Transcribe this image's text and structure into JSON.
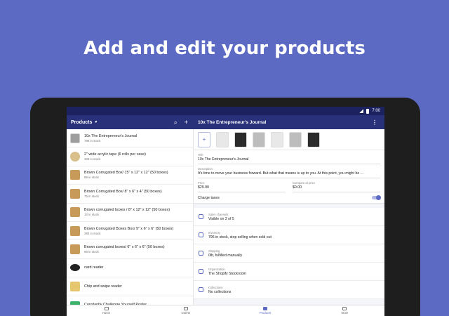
{
  "headline": "Add and edit your products",
  "status": {
    "time": "7:00"
  },
  "appbar": {
    "products_title": "Products",
    "search_icon": "⌕",
    "add_icon": "+",
    "detail_title": "10x The Entrepreneur's Journal",
    "more_icon": "⋮"
  },
  "products": [
    {
      "title": "10x The Entrepreneur's Journal",
      "stock": "796 in stock",
      "thumb": "book"
    },
    {
      "title": "2\" wide acrylic tape (6 rolls per case)",
      "stock": "323 in stock",
      "thumb": "tape"
    },
    {
      "title": "Brown Corrugated Box/ 15\" x 12\" x 12\" (50 boxes)",
      "stock": "88 in stock",
      "thumb": "box"
    },
    {
      "title": "Brown Corrugated Box/ 8\" x 6\" x 4\" (50 boxes)",
      "stock": "75 in stock",
      "thumb": "box"
    },
    {
      "title": "Brown corrugated boxes /  8\" x 12\" x 12\" (50 boxes)",
      "stock": "10 in stock",
      "thumb": "box"
    },
    {
      "title": "Brown Corrugated Boxes Box/ 9\" x 6\" x 6\" (50 boxes)",
      "stock": "393 in stock",
      "thumb": "box"
    },
    {
      "title": "Brown corrugated boxes/ 6\" x 6\" x 6\" (50 boxes)",
      "stock": "66 in stock",
      "thumb": "box"
    },
    {
      "title": "card reader",
      "stock": "",
      "thumb": "reader"
    },
    {
      "title": "Chip and swipe reader",
      "stock": "",
      "thumb": "chip"
    },
    {
      "title": "Constantly Challenge Yourself Poster",
      "stock": "",
      "thumb": "poster"
    }
  ],
  "detail": {
    "add_image_icon": "+",
    "title_label": "Title",
    "title_value": "10x The Entrepreneur's Journal",
    "description_label": "Description",
    "description_value": "It's time to move your business forward. But what that means is up to you. At this point, you might be ...",
    "price_label": "Price",
    "price_value": "$29.90",
    "compare_label": "Compare at price",
    "compare_value": "$0.00",
    "charge_taxes": "Charge taxes",
    "charge_taxes_on": true,
    "sales_label": "Sales channels",
    "sales_value": "Visible on 2 of 5",
    "inventory_label": "Inventory",
    "inventory_value": "796 in stock, stop selling when sold out",
    "shipping_label": "Shipping",
    "shipping_value": "0lb, fulfilled manually",
    "organization_label": "Organization",
    "organization_value": "The Shopify Stockroom",
    "collections_label": "Collections",
    "collections_value": "No collections"
  },
  "bottomnav": [
    {
      "label": "Home",
      "active": false
    },
    {
      "label": "Orders",
      "active": false
    },
    {
      "label": "Products",
      "active": true
    },
    {
      "label": "Store",
      "active": false
    }
  ],
  "colors": {
    "background": "#5c6ac4",
    "appbar": "#2a317b",
    "statusbar": "#1c2260",
    "accent": "#5c6ac4"
  }
}
